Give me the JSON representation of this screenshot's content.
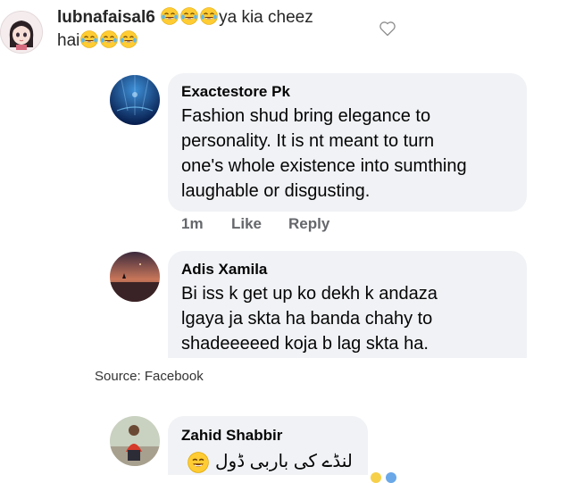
{
  "top_comment": {
    "username": "lubnafaisal6",
    "text_line1": "ya kia cheez",
    "text_line2_prefix": "hai",
    "emoji": "tears-of-joy"
  },
  "replies": [
    {
      "author": "Exactestore Pk",
      "text": [
        "Fashion shud bring elegance to",
        "personality. It is nt meant to turn",
        "one's whole existence into sumthing",
        "laughable or disgusting."
      ],
      "time": "1m",
      "like_label": "Like",
      "reply_label": "Reply"
    },
    {
      "author": "Adis Xamila",
      "text": [
        "Bi iss k get up ko dekh k andaza",
        "lgaya ja skta ha banda chahy to",
        "shadeeeeed koja b lag skta ha."
      ]
    },
    {
      "author": "Zahid Shabbir",
      "text": [
        "لنڈے کی باربی ڈول"
      ]
    }
  ],
  "source": "Source: Facebook"
}
